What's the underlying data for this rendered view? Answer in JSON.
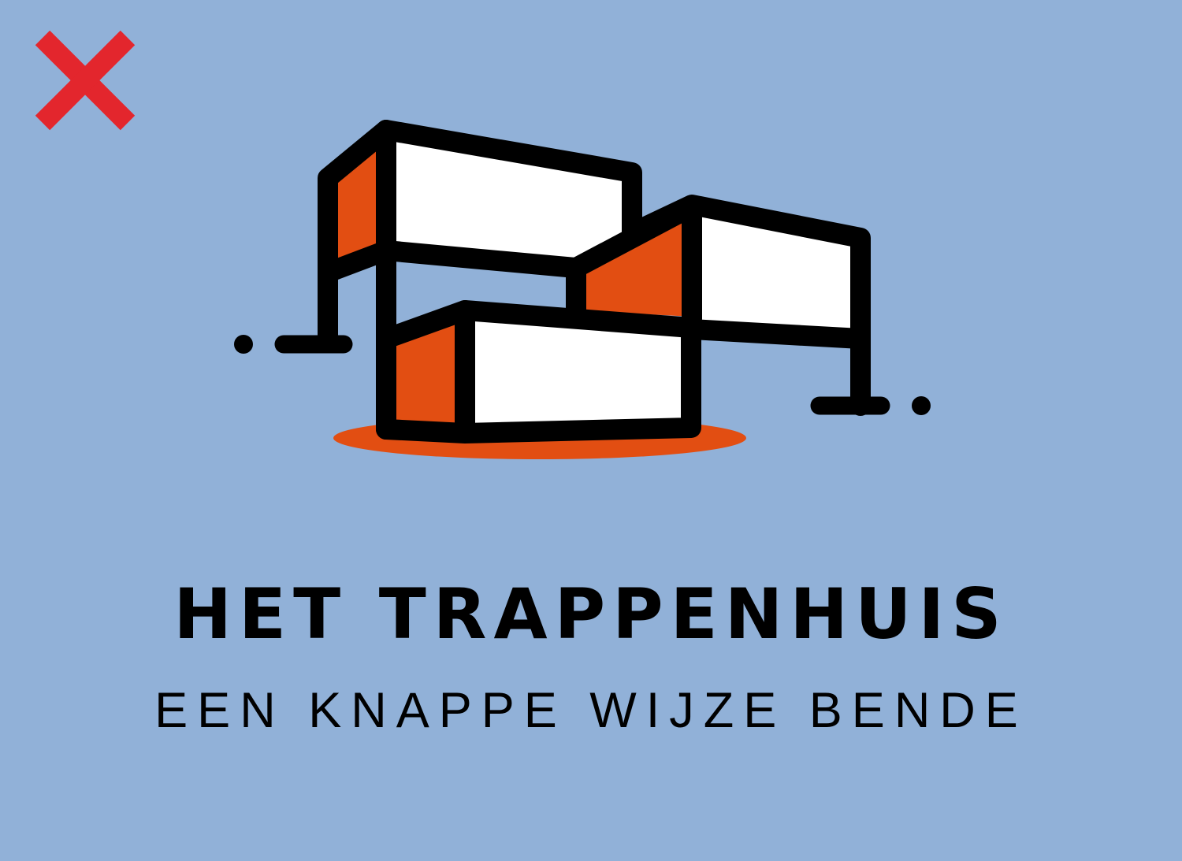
{
  "logo": {
    "title": "HET TRAPPENHUIS",
    "tagline": "EEN KNAPPE WIJZE BENDE"
  },
  "colors": {
    "background": "#91b1d8",
    "outline": "#000000",
    "accent_orange": "#e24e12",
    "fill_white": "#ffffff",
    "close_red": "#e3262d"
  },
  "icons": {
    "close": "close-icon",
    "logo": "building-stack-icon"
  }
}
